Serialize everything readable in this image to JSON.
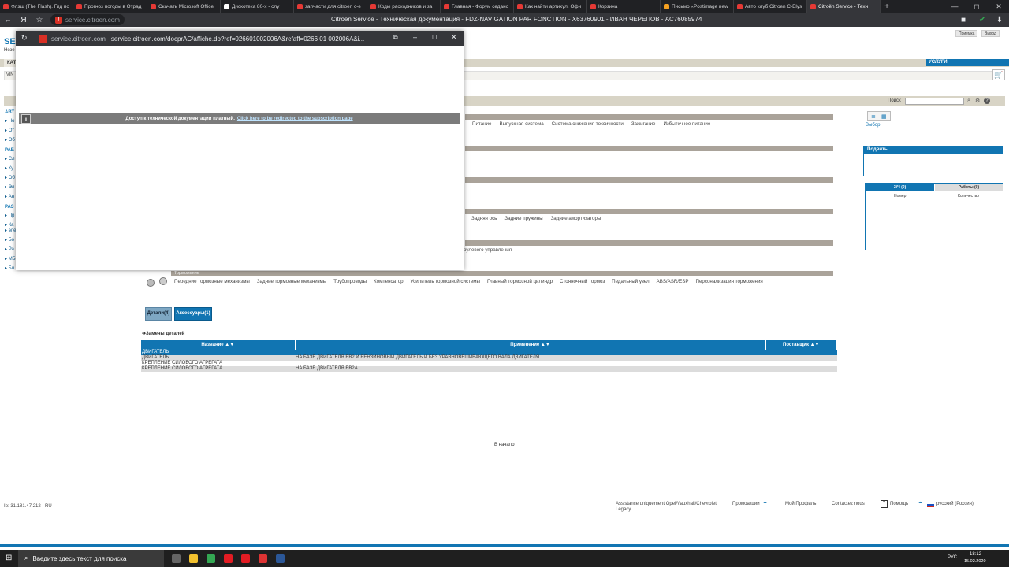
{
  "browser": {
    "tabs": [
      {
        "title": "Флэш (The Flash). Гид по",
        "color": "#e53935"
      },
      {
        "title": "Прогноз погоды в Отрад",
        "color": "#e53935"
      },
      {
        "title": "Скачать Microsoft Office",
        "color": "#e53935"
      },
      {
        "title": "Дискотека 80-х - слу",
        "color": "#fff"
      },
      {
        "title": "запчасти для citroen c-e",
        "color": "#e53935"
      },
      {
        "title": "Коды расходников и за",
        "color": "#e53935"
      },
      {
        "title": "Главная - Форум седанс",
        "color": "#e53935"
      },
      {
        "title": "Как найти артикул. Офи",
        "color": "#e53935"
      },
      {
        "title": "Корзина",
        "color": "#e53935"
      },
      {
        "title": "Письмо «Postimage new",
        "color": "#f4a020"
      },
      {
        "title": "Авто клуб Citroen C-Elys",
        "color": "#e53935"
      },
      {
        "title": "Citroën Service - Техн",
        "color": "#e53935",
        "active": true
      }
    ],
    "new_tab": "+",
    "address_url": "service.citroen.com",
    "page_title": "Citroën Service - Техническая документация - FDZ-NAVIGATION PAR FONCTION - X63760901 - ИВАН ЧЕРЕПОВ - AC76085974",
    "window_buttons": [
      "—",
      "◻",
      "✕"
    ]
  },
  "popup": {
    "host": "service.citroen.com",
    "url": "service.citroen.com/docprAC/affiche.do?ref=026601002006A&refaff=0266 01 002006A&i...",
    "notice_text": "Доступ к технической документации платный.",
    "notice_link": "Click here to be redirected to the subscription page"
  },
  "page": {
    "brand": "SE",
    "brand_sub": "Незе",
    "top_buttons": [
      "Приемка",
      "Выход"
    ],
    "services_label": "УСЛУГИ",
    "tab_label": "КАТ",
    "vin_label": "VIN",
    "search_label": "Поиск",
    "select_label": "Выбор",
    "left_nav": [
      {
        "label": "АВТ",
        "section": true
      },
      {
        "label": "Но"
      },
      {
        "label": "От"
      },
      {
        "label": "Об"
      },
      {
        "label": "РАБ",
        "section": true
      },
      {
        "label": "Сл"
      },
      {
        "label": "Ку"
      },
      {
        "label": "Об"
      },
      {
        "label": "Эл"
      },
      {
        "label": "Ан"
      },
      {
        "label": "РАЗ",
        "section": true
      },
      {
        "label": "Пр"
      },
      {
        "label": "Ка"
      },
      {
        "label": "эле"
      },
      {
        "label": "Бо"
      },
      {
        "label": "Ра"
      },
      {
        "label": "МБ"
      },
      {
        "label": "Бл"
      }
    ],
    "row1_menu": [
      "Питание",
      "Выпускная система",
      "Система снижения токсичности",
      "Зажигание",
      "Избыточное питание"
    ],
    "row3_menu": [
      "Задняя ось",
      "Задние пружины",
      "Задние амортизаторы"
    ],
    "row4_menu": [
      "рулевого управления"
    ],
    "brakes_title": "Торможение",
    "brakes_menu": [
      "Передние тормозные механизмы",
      "Задние тормозные механизмы",
      "Трубопроводы",
      "Компенсатор",
      "Усилитель тормозной системы",
      "Главный тормозной цилиндр",
      "Стояночный тормоз",
      "Педальный узел",
      "ABS/ASR/ESP",
      "Персонализация торможения"
    ],
    "detail_tabs": [
      "Детали(4)",
      "Аксессуары(1)"
    ],
    "replacements_title": "Замены деталей",
    "table": {
      "headers": [
        "Название ▲▼",
        "Применение ▲▼",
        "Поставщик ▲▼"
      ],
      "rows": [
        {
          "name": "ДВИГАТЕЛЬ",
          "use": "",
          "supplier": "",
          "selected": true
        },
        {
          "name": "ДВИГАТЕЛЬ",
          "use": "НА БАЗЕ ДВИГАТЕЛЯ EB2 И БЕНЗИНОВЫЙ ДВИГАТЕЛЬ И БЕЗ УРАВНОВЕШИВАЮЩЕГО ВАЛА ДВИГАТЕЛЯ",
          "supplier": ""
        },
        {
          "name": "КРЕПЛЕНИЕ СИЛОВОГО АГРЕГАТА",
          "use": "",
          "supplier": ""
        },
        {
          "name": "КРЕПЛЕНИЕ СИЛОВОГО АГРЕГАТА",
          "use": "НА БАЗЕ ДВИГАТЕЛЯ EB2A",
          "supplier": ""
        }
      ]
    },
    "to_top": "В начало",
    "right_panel": {
      "submit_title": "Подвить",
      "tabs": [
        "З/Ч (0)",
        "Работы (0)"
      ],
      "cols": [
        "Номер",
        "Количество"
      ]
    },
    "footer": {
      "ip": "Ip: 31.181.47.212 - RU",
      "assistance": "Assistance uniquement Opel/Vauxhall/Chevrolet Legacy",
      "promos": "Промоакции",
      "profile": "Мой Профиль",
      "contact": "Contactez nous",
      "help": "Помощь",
      "lang": "русский (Россия)"
    }
  },
  "taskbar": {
    "search_placeholder": "Введите здесь текст для поиска",
    "lang": "РУС",
    "time": "18:12",
    "date": "15.02.2020",
    "apps": [
      {
        "name": "task-view",
        "color": "#666"
      },
      {
        "name": "explorer",
        "color": "#f2c12e"
      },
      {
        "name": "chrome",
        "color": "#34a853"
      },
      {
        "name": "opera",
        "color": "#e31c23"
      },
      {
        "name": "yandex",
        "color": "#e31c23"
      },
      {
        "name": "app-x",
        "color": "#d33"
      },
      {
        "name": "word",
        "color": "#2b5797"
      }
    ]
  }
}
